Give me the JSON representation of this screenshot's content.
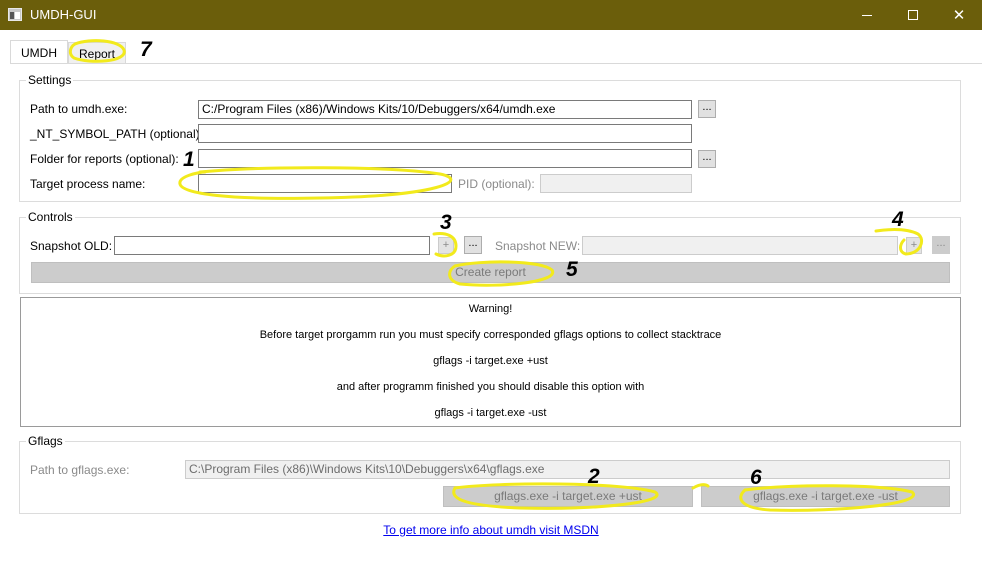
{
  "window": {
    "title": "UMDH-GUI"
  },
  "tabs": [
    {
      "label": "UMDH"
    },
    {
      "label": "Report"
    }
  ],
  "settings": {
    "legend": "Settings",
    "umdh_path": {
      "label": "Path to umdh.exe:",
      "value": "C:/Program Files (x86)/Windows Kits/10/Debuggers/x64/umdh.exe"
    },
    "symbol_path": {
      "label": "_NT_SYMBOL_PATH (optional):",
      "value": ""
    },
    "reports_folder": {
      "label": "Folder for reports (optional):",
      "value": ""
    },
    "target_process": {
      "label": "Target process name:",
      "value": ""
    },
    "pid": {
      "label": "PID (optional):",
      "value": ""
    },
    "browse_label": "..."
  },
  "controls": {
    "legend": "Controls",
    "snapshot_old": {
      "label": "Snapshot OLD:",
      "value": ""
    },
    "snapshot_new": {
      "label": "Snapshot NEW:",
      "value": ""
    },
    "plus_label": "+",
    "browse_label": "...",
    "create_report": "Create report"
  },
  "warning": {
    "lines": [
      "Warning!",
      "Before target prorgamm run you must specify corresponded gflags options to collect stacktrace",
      "gflags -i target.exe +ust",
      "and after programm finished you should disable this option with",
      "gflags -i target.exe -ust"
    ]
  },
  "gflags": {
    "legend": "Gflags",
    "path": {
      "label": "Path to gflags.exe:",
      "value": "C:\\Program Files (x86)\\Windows Kits\\10\\Debuggers\\x64\\gflags.exe"
    },
    "enable_button": "gflags.exe -i target.exe +ust",
    "disable_button": "gflags.exe -i target.exe -ust"
  },
  "link": {
    "text": "To get more info about umdh visit MSDN"
  },
  "annotations": {
    "color": "#f2ea1c",
    "labels": [
      "1",
      "2",
      "3",
      "4",
      "5",
      "6",
      "7"
    ]
  },
  "colors": {
    "titlebar": "#6b5e0b",
    "link": "#0000ee"
  }
}
